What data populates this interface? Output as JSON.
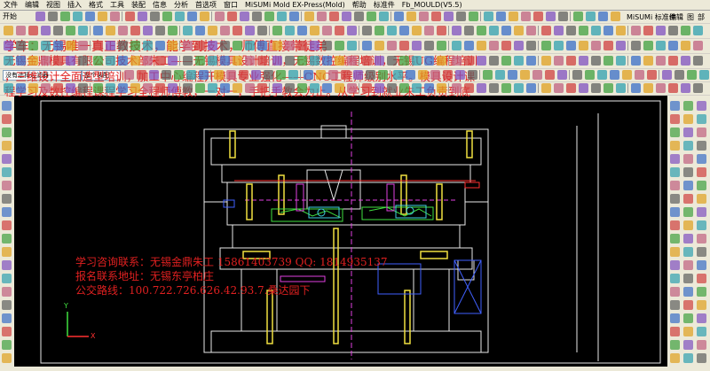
{
  "window": {
    "title": "MiSUMi Mold EX-Press(Mold)",
    "tab": "Fb_MOULD(V5.5)"
  },
  "menu": [
    "文件",
    "编辑",
    "视图",
    "插入",
    "格式",
    "工具",
    "装配",
    "信息",
    "分析",
    "首选项",
    "窗口",
    "MiSUMi Mold EX-Press(Mold)",
    "帮助",
    "标准件",
    "Fb_MOULD(V5.5)"
  ],
  "toolbar": {
    "start_label": "开始",
    "misumi_label": "MiSUMi 标准件",
    "edit_label": "编辑",
    "view_label": "图",
    "parts_label": "部品表"
  },
  "filters": {
    "selection_filter": "没有选择过滤器",
    "assembly": "整个装配"
  },
  "overlay": {
    "line1": "学车：无锡唯一真正教技术，能学到技术，师傅直接带徒弟",
    "line2": "无锡金鼎模具有限公司技术部朱工——无锡模具设计培训，无锡数控编程培训，无锡UG编程培训",
    "line3": "，三维设计全面造型培训，加工中心编程开模具专业强化——CNC工程师级别水平。模具设计课",
    "line4": "程学习及数控编程课程学习全程师傅教，一对一，手把手教会为止。从学习到就业朱工负责到底"
  },
  "contact": {
    "line1": "学习咨询联系：无锡金鼎朱工 15861403739 QQ: 1814935137",
    "line2": "报名联系地址：无锡东亭柏庄",
    "line3": "公交路线：100.722.726.626.42.93.7.桑达园下"
  },
  "axis": {
    "x": "X",
    "y": "Y"
  },
  "colors": {
    "overlay_text": "#e02020",
    "cad_white": "#e8e8e8",
    "cad_yellow": "#f0e040",
    "cad_green": "#40e040",
    "cad_magenta": "#e040e0",
    "cad_blue": "#4060ff",
    "cad_red": "#ff3030"
  }
}
